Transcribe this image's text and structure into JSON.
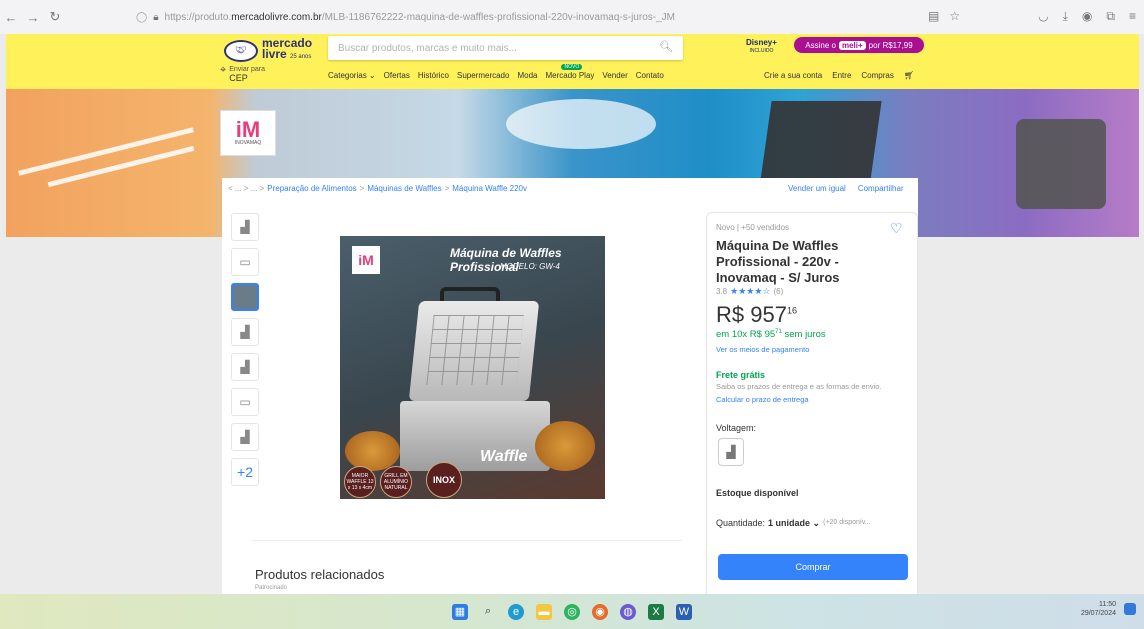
{
  "browser": {
    "url_prefix": "https://produto.",
    "url_domain": "mercadolivre.com.br",
    "url_path": "/MLB-1186762222-maquina-de-waffles-profissional-220v-inovamaq-s-juros-_JM"
  },
  "header": {
    "logo_line1": "mercado",
    "logo_line2": "livre",
    "logo_anniv": "25 anos",
    "search_placeholder": "Buscar produtos, marcas e muito mais...",
    "cep_small": "Enviar para",
    "cep_label": "CEP",
    "nav": [
      "Categorias ⌄",
      "Ofertas",
      "Histórico",
      "Supermercado",
      "Moda",
      "Mercado Play",
      "Vender",
      "Contato"
    ],
    "novo_badge": "NOVO",
    "disney": "Disney+",
    "disney_sub": "INCLUIDO",
    "meli_prefix": "Assine o",
    "meli_brand": "meli+",
    "meli_price": "por R$17,99",
    "account": [
      "Crie a sua conta",
      "Entre",
      "Compras"
    ]
  },
  "banner": {
    "brand_name": "INOVAMAQ"
  },
  "breadcrumb": {
    "items": [
      "Preparação de Alimentos",
      "Máquinas de Waffles",
      "Máquina Waffle 220v"
    ],
    "vender": "Vender um igual",
    "compartilhar": "Compartilhar"
  },
  "gallery": {
    "more": "+2",
    "image_title": "Máquina de Waffles Profissional",
    "image_model": "MODELO: GW-4",
    "badge1": "MAIOR WAFFLE 13 x 13 x 4cm",
    "badge2": "GRILL EM ALUMÍNIO NATURAL",
    "badge3": "INOX",
    "waffle_word": "Waffle"
  },
  "product": {
    "condition": "Novo  |  +50 vendidos",
    "title": "Máquina De Waffles Profissional - 220v - Inovamaq - S/ Juros",
    "rating": "3.8",
    "stars": "★★★★☆",
    "reviews": "(6)",
    "price_main": "R$ 957",
    "price_cents": "16",
    "inst_prefix": "em ",
    "inst_value": "10x R$ 95",
    "inst_cents": "71",
    "inst_suffix": " sem juros",
    "payments_link": "Ver os meios de pagamento",
    "frete": "Frete grátis",
    "frete_sub": "Saiba os prazos de entrega e as formas de envio.",
    "frete_link": "Calcular o prazo de entrega",
    "voltagem": "Voltagem:",
    "stock": "Estoque disponível",
    "qty_label": "Quantidade:",
    "qty_value": "1 unidade ⌄",
    "qty_avail": "(+20 disponív...",
    "buy": "Comprar"
  },
  "related": {
    "title": "Produtos relacionados",
    "sponsored": "Patrocinado"
  },
  "taskbar": {
    "time": "11:50",
    "date": "29/07/2024"
  }
}
